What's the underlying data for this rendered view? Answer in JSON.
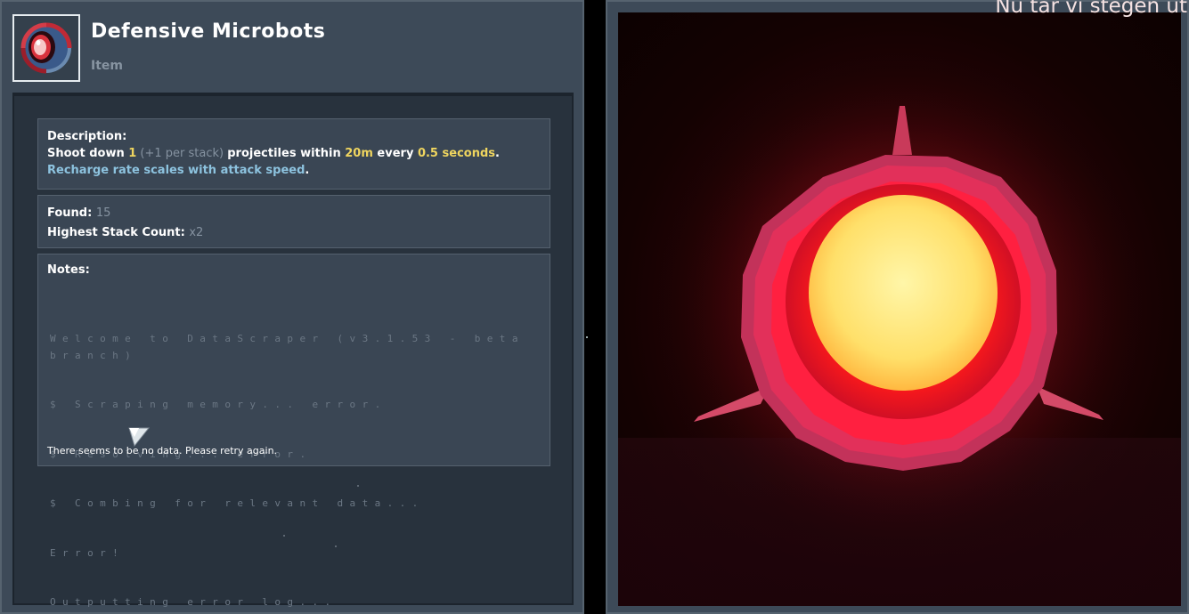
{
  "item": {
    "name": "Defensive Microbots",
    "type": "Item",
    "icon": "microbots-item-icon"
  },
  "description": {
    "heading": "Description:",
    "part1": "Shoot down ",
    "count": "1",
    "stack": " (+1 per stack) ",
    "part2": "projectiles within ",
    "range": "20m",
    "part3": " every ",
    "interval": "0.5 seconds",
    "part4": ". ",
    "recharge": "Recharge rate scales with attack speed",
    "part5": "."
  },
  "stats": {
    "found_label": "Found:",
    "found_value": "15",
    "stack_label": "Highest Stack Count:",
    "stack_value": "x2"
  },
  "notes": {
    "heading": "Notes:",
    "log_lines": [
      "Welcome to DataScraper (v3.1.53 - beta branch)",
      "$ Scraping memory... error.",
      "$ Resolving... error.",
      "$ Combing for relevant data...",
      "Error!",
      "Outputting error log..."
    ],
    "no_data": "There seems to be no data. Please retry again."
  },
  "caption": "Nu tar vi stegen ut",
  "colors": {
    "panel": "#3d4a58",
    "highlight_yellow": "#efd55f",
    "highlight_blue": "#8dc3df",
    "dim_text": "#8592a0"
  }
}
